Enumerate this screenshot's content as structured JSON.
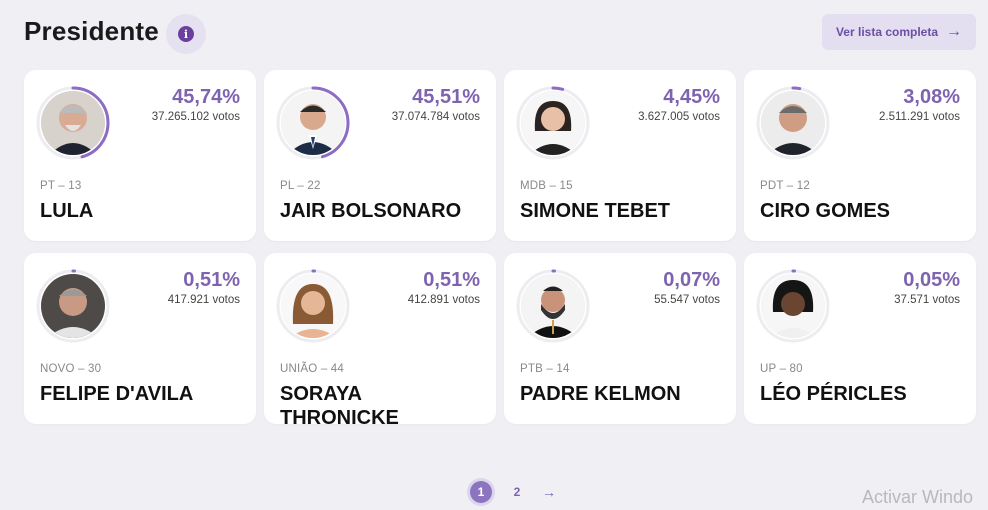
{
  "header": {
    "title": "Presidente",
    "info_icon": "info-icon",
    "full_list_label": "Ver lista completa",
    "full_list_icon": "arrow-right-icon"
  },
  "colors": {
    "accent": "#7e63b0",
    "ring": "#8d6cc4",
    "ring_track": "#ececf1",
    "background": "#efeff4"
  },
  "candidates": [
    {
      "percent": "45,74%",
      "share": 0.4574,
      "votes": "37.265.102 votos",
      "party": "PT – 13",
      "name": "LULA",
      "photo": "lula-photo"
    },
    {
      "percent": "45,51%",
      "share": 0.4551,
      "votes": "37.074.784 votos",
      "party": "PL – 22",
      "name": "JAIR BOLSONARO",
      "photo": "bolsonaro-photo"
    },
    {
      "percent": "4,45%",
      "share": 0.0445,
      "votes": "3.627.005 votos",
      "party": "MDB – 15",
      "name": "SIMONE TEBET",
      "photo": "tebet-photo"
    },
    {
      "percent": "3,08%",
      "share": 0.0308,
      "votes": "2.511.291 votos",
      "party": "PDT – 12",
      "name": "CIRO GOMES",
      "photo": "ciro-photo"
    },
    {
      "percent": "0,51%",
      "share": 0.0051,
      "votes": "417.921 votos",
      "party": "NOVO – 30",
      "name": "FELIPE D'AVILA",
      "photo": "davila-photo"
    },
    {
      "percent": "0,51%",
      "share": 0.0051,
      "votes": "412.891 votos",
      "party": "UNIÃO – 44",
      "name": "SORAYA THRONICKE",
      "photo": "soraya-photo"
    },
    {
      "percent": "0,07%",
      "share": 0.0007,
      "votes": "55.547 votos",
      "party": "PTB – 14",
      "name": "PADRE KELMON",
      "photo": "kelmon-photo"
    },
    {
      "percent": "0,05%",
      "share": 0.0005,
      "votes": "37.571 votos",
      "party": "UP – 80",
      "name": "LÉO PÉRICLES",
      "photo": "pericles-photo"
    }
  ],
  "pagination": {
    "pages": [
      "1",
      "2"
    ],
    "current": "1",
    "next_icon": "arrow-right-icon"
  },
  "watermark": "Activar Windo"
}
